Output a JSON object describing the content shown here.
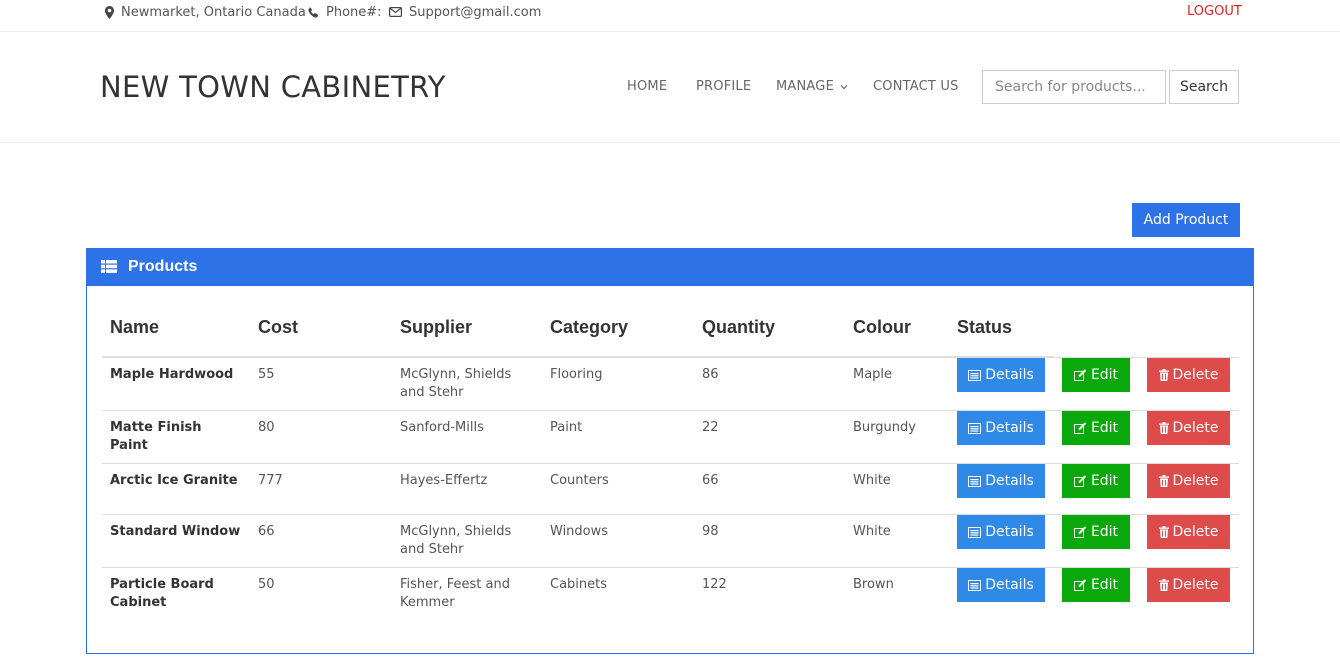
{
  "topbar": {
    "location": "Newmarket, Ontario Canada",
    "phone": "Phone#:",
    "email": "Support@gmail.com",
    "logout": "LOGOUT"
  },
  "header": {
    "brand": "NEW TOWN CABINETRY",
    "nav": [
      "HOME",
      "PROFILE",
      "MANAGE",
      "CONTACT US"
    ],
    "search_placeholder": "Search for products...",
    "search_button": "Search"
  },
  "actions": {
    "add_product": "Add Product"
  },
  "panel": {
    "title": "Products",
    "columns": [
      "Name",
      "Cost",
      "Supplier",
      "Category",
      "Quantity",
      "Colour",
      "Status"
    ],
    "row_buttons": {
      "details": "Details",
      "edit": "Edit",
      "delete": "Delete"
    },
    "rows": [
      {
        "name": "Maple Hardwood",
        "cost": "55",
        "supplier": "McGlynn, Shields and Stehr",
        "category": "Flooring",
        "quantity": "86",
        "colour": "Maple"
      },
      {
        "name": "Matte Finish Paint",
        "cost": "80",
        "supplier": "Sanford-Mills",
        "category": "Paint",
        "quantity": "22",
        "colour": "Burgundy"
      },
      {
        "name": "Arctic Ice Granite",
        "cost": "777",
        "supplier": "Hayes-Effertz",
        "category": "Counters",
        "quantity": "66",
        "colour": "White"
      },
      {
        "name": "Standard Window",
        "cost": "66",
        "supplier": "McGlynn, Shields and Stehr",
        "category": "Windows",
        "quantity": "98",
        "colour": "White"
      },
      {
        "name": "Particle Board Cabinet",
        "cost": "50",
        "supplier": "Fisher, Feest and Kemmer",
        "category": "Cabinets",
        "quantity": "122",
        "colour": "Brown"
      }
    ]
  },
  "colors": {
    "primary": "#2e72e8",
    "details": "#2e8ae6",
    "edit": "#0aa80a",
    "delete": "#dd4b4b",
    "logout": "#e02020"
  }
}
